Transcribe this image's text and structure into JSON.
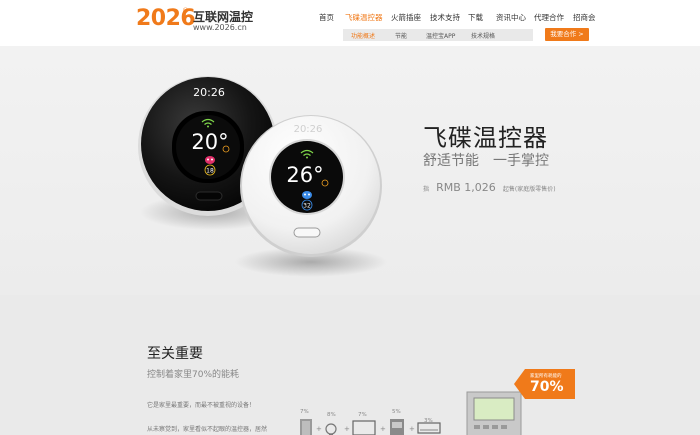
{
  "header": {
    "logo_number": "2026",
    "logo_registered": "®",
    "logo_cn": "互联网温控",
    "logo_url": "www.2026.cn",
    "nav": [
      "首页",
      "飞碟温控器",
      "火箭插座",
      "技术支持",
      "下载",
      "资讯中心",
      "代理合作",
      "招商会"
    ],
    "nav_active_index": 1,
    "subnav": [
      "功能概述",
      "节能",
      "温控宝APP",
      "技术规格"
    ],
    "subnav_active_index": 0,
    "join_button": "我要合作 >"
  },
  "hero": {
    "title": "飞碟温控器",
    "subtitle": "舒适节能　一手掌控",
    "price_prefix": "指",
    "price_value": "RMB 1,026",
    "price_note": "起售(家庭版零售价)",
    "black_device": {
      "time": "20:26",
      "temp": "20°",
      "badge": "18"
    },
    "white_device": {
      "time": "20:26",
      "temp": "26°",
      "badge": "32"
    }
  },
  "section": {
    "title": "至关重要",
    "subtitle": "控制着家里70%的能耗",
    "paragraph1": "它是家里最重要，而最不被重视的设备！",
    "paragraph2": "从未察觉到，家里看似不起眼的温控器，居然",
    "percentages": [
      "7%",
      "8%",
      "7%",
      "5%",
      "3%"
    ],
    "badge_label": "家里所有耗能的",
    "badge_value": "70%"
  },
  "colors": {
    "accent": "#f07a1a",
    "hero_bg": "#efefef",
    "lower_bg": "#eaeaea",
    "device_black": "#1a1a1a",
    "device_white": "#f4f4f4"
  },
  "icons": [
    "wifi-icon",
    "flame-icon",
    "robot-face-icon",
    "door-icon",
    "bulb-icon",
    "monitor-icon",
    "fridge-icon",
    "ac-icon"
  ]
}
